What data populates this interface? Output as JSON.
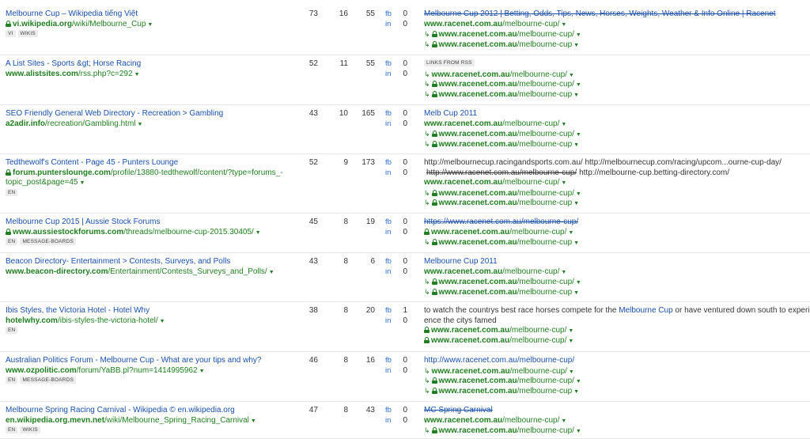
{
  "rows": [
    {
      "title": "Melbourne Cup – Wikipedia tiếng Việt",
      "url_domain": "vi.wikipedia.org",
      "url_path": "/wiki/Melbourne_Cup",
      "secure": true,
      "tags": [
        "VI",
        "WIKIS"
      ],
      "dr": "73",
      "ur": "16",
      "ref": "55",
      "fb": "0",
      "in": "0",
      "anchor": {
        "kind": "link",
        "text": "Melbourne Cup 2012 | Betting, Odds, Tips, News, Horses, Weights, Weather & Info Online | Racenet",
        "strike": true
      },
      "targets": [
        {
          "arrow": false,
          "secure": false,
          "domain": "www.racenet.com.au",
          "path": "/melbourne-cup/"
        },
        {
          "arrow": true,
          "secure": true,
          "domain": "www.racenet.com.au",
          "path": "/melbourne-cup/"
        },
        {
          "arrow": true,
          "secure": true,
          "domain": "www.racenet.com.au",
          "path": "/melbourne-cup"
        }
      ]
    },
    {
      "title": "A List Sites - Sports &gt; Horse Racing",
      "url_domain": "www.alistsites.com",
      "url_path": "/rss.php?c=292",
      "secure": false,
      "tags": [],
      "dr": "52",
      "ur": "11",
      "ref": "55",
      "fb": "0",
      "in": "0",
      "anchor": {
        "kind": "tag",
        "text": "LINKS FROM RSS"
      },
      "targets": [
        {
          "arrow": true,
          "secure": false,
          "domain": "www.racenet.com.au",
          "path": "/melbourne-cup/"
        },
        {
          "arrow": true,
          "secure": true,
          "domain": "www.racenet.com.au",
          "path": "/melbourne-cup/"
        },
        {
          "arrow": true,
          "secure": true,
          "domain": "www.racenet.com.au",
          "path": "/melbourne-cup"
        }
      ]
    },
    {
      "title": "SEO Friendly General Web Directory - Recreation > Gambling",
      "url_domain": "a2adir.info",
      "url_path": "/recreation/Gambling.html",
      "secure": false,
      "tags": [],
      "dr": "43",
      "ur": "10",
      "ref": "165",
      "fb": "0",
      "in": "0",
      "anchor": {
        "kind": "link",
        "text": "Melb Cup 2011",
        "strike": false
      },
      "targets": [
        {
          "arrow": false,
          "secure": false,
          "domain": "www.racenet.com.au",
          "path": "/melbourne-cup/"
        },
        {
          "arrow": true,
          "secure": true,
          "domain": "www.racenet.com.au",
          "path": "/melbourne-cup/"
        },
        {
          "arrow": true,
          "secure": true,
          "domain": "www.racenet.com.au",
          "path": "/melbourne-cup"
        }
      ]
    },
    {
      "title": "Tedthewolf's Content - Page 45 - Punters Lounge",
      "url_domain": "forum.punterslounge.com",
      "url_path": "/profile/13880-tedthewolf/content/?type=forums_-",
      "url_cont": "topic_post&page=45",
      "secure": true,
      "tags": [
        "EN"
      ],
      "dr": "52",
      "ur": "9",
      "ref": "173",
      "fb": "0",
      "in": "0",
      "anchor": {
        "kind": "mixed",
        "line1": "http://melbournecup.racingandsports.com.au/ http://melbournecup.com/racing/upcom...ourne-cup-day/",
        "line2_strike": "http://www.racenet.com.au/melbourne-cup/",
        "line2_text": "http://melbourne-cup.betting-directory.com/"
      },
      "targets": [
        {
          "arrow": false,
          "secure": false,
          "domain": "www.racenet.com.au",
          "path": "/melbourne-cup/"
        },
        {
          "arrow": true,
          "secure": true,
          "domain": "www.racenet.com.au",
          "path": "/melbourne-cup/"
        },
        {
          "arrow": true,
          "secure": true,
          "domain": "www.racenet.com.au",
          "path": "/melbourne-cup"
        }
      ]
    },
    {
      "title": "Melbourne Cup 2015 | Aussie Stock Forums",
      "url_domain": "www.aussiestockforums.com",
      "url_path": "/threads/melbourne-cup-2015.30405/",
      "secure": true,
      "tags": [
        "EN",
        "MESSAGE-BOARDS"
      ],
      "dr": "45",
      "ur": "8",
      "ref": "19",
      "fb": "0",
      "in": "0",
      "anchor": {
        "kind": "link",
        "text": "https://www.racenet.com.au/melbourne-cup/",
        "strike": true
      },
      "targets": [
        {
          "arrow": false,
          "secure": true,
          "domain": "www.racenet.com.au",
          "path": "/melbourne-cup/"
        },
        {
          "arrow": true,
          "secure": true,
          "domain": "www.racenet.com.au",
          "path": "/melbourne-cup"
        }
      ]
    },
    {
      "title": "Beacon Directory- Entertainment > Contests, Surveys, and Polls",
      "url_domain": "www.beacon-directory.com",
      "url_path": "/Entertainment/Contests_Surveys_and_Polls/",
      "secure": false,
      "tags": [],
      "dr": "43",
      "ur": "8",
      "ref": "6",
      "fb": "0",
      "in": "0",
      "anchor": {
        "kind": "link",
        "text": "Melbourne Cup 2011",
        "strike": false
      },
      "targets": [
        {
          "arrow": false,
          "secure": false,
          "domain": "www.racenet.com.au",
          "path": "/melbourne-cup/"
        },
        {
          "arrow": true,
          "secure": true,
          "domain": "www.racenet.com.au",
          "path": "/melbourne-cup/"
        },
        {
          "arrow": true,
          "secure": true,
          "domain": "www.racenet.com.au",
          "path": "/melbourne-cup"
        }
      ]
    },
    {
      "title": "Ibis Styles, the Victoria Hotel - Hotel Why",
      "url_domain": "hotelwhy.com",
      "url_path": "/ibis-styles-the-victoria-hotel/",
      "secure": false,
      "tags": [
        "EN"
      ],
      "dr": "38",
      "ur": "8",
      "ref": "20",
      "fb": "1",
      "in": "0",
      "anchor": {
        "kind": "context",
        "before": "to watch the countrys best race horses compete for the ",
        "link": "Melbourne Cup",
        "after": " or have ventured down south to experi-",
        "line2": "ence the citys famed"
      },
      "targets": [
        {
          "arrow": false,
          "secure": true,
          "domain": "www.racenet.com.au",
          "path": "/melbourne-cup/"
        },
        {
          "arrow": false,
          "secure": true,
          "domain": "www.racenet.com.au",
          "path": "/melbourne-cup/"
        }
      ]
    },
    {
      "title": "Australian Politics Forum - Melbourne Cup - What are your tips and why?",
      "url_domain": "www.ozpolitic.com",
      "url_path": "/forum/YaBB.pl?num=1414995962",
      "secure": false,
      "tags": [
        "EN",
        "MESSAGE-BOARDS"
      ],
      "dr": "46",
      "ur": "8",
      "ref": "16",
      "fb": "0",
      "in": "0",
      "anchor": {
        "kind": "link",
        "text": "http://www.racenet.com.au/melbourne-cup/",
        "strike": false
      },
      "targets": [
        {
          "arrow": true,
          "secure": false,
          "domain": "www.racenet.com.au",
          "path": "/melbourne-cup/"
        },
        {
          "arrow": true,
          "secure": true,
          "domain": "www.racenet.com.au",
          "path": "/melbourne-cup/"
        },
        {
          "arrow": true,
          "secure": true,
          "domain": "www.racenet.com.au",
          "path": "/melbourne-cup"
        }
      ]
    },
    {
      "title": "Melbourne Spring Racing Carnival - Wikipedia © en.wikipedia.org",
      "url_domain": "en.wikipedia.org.mevn.net",
      "url_path": "/wiki/Melbourne_Spring_Racing_Carnival",
      "secure": false,
      "tags": [
        "EN",
        "WIKIS"
      ],
      "dr": "47",
      "ur": "8",
      "ref": "43",
      "fb": "0",
      "in": "0",
      "anchor": {
        "kind": "link",
        "text": "MC Spring Carnival",
        "strike": true
      },
      "targets": [
        {
          "arrow": false,
          "secure": false,
          "domain": "www.racenet.com.au",
          "path": "/melbourne-cup/"
        },
        {
          "arrow": true,
          "secure": true,
          "domain": "www.racenet.com.au",
          "path": "/melbourne-cup/"
        }
      ]
    }
  ],
  "labels": {
    "fb": "fb",
    "in": "in"
  }
}
